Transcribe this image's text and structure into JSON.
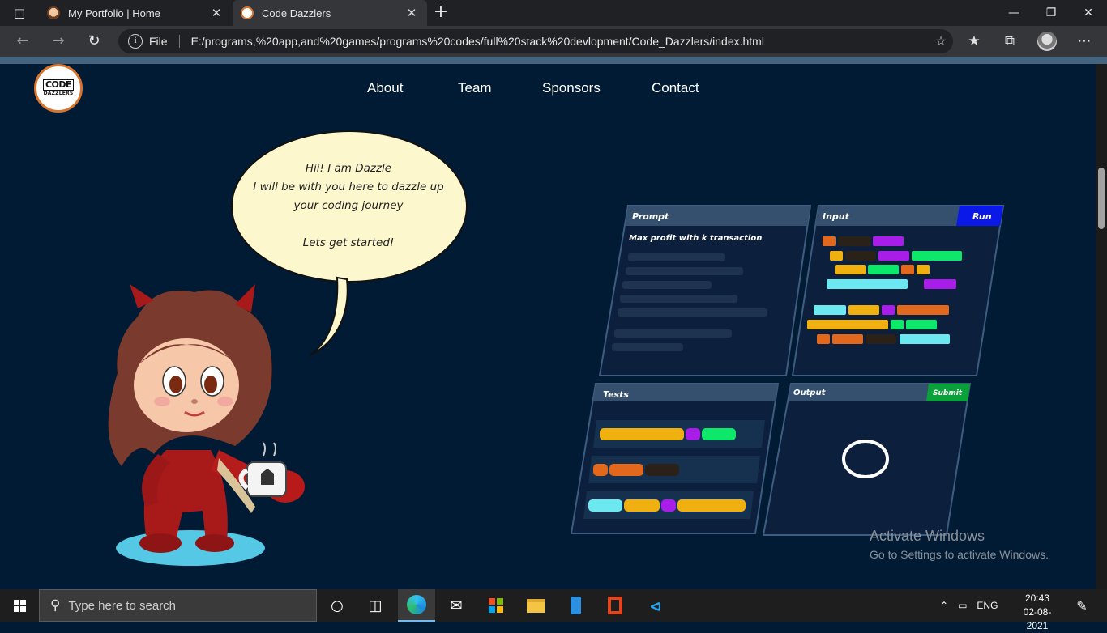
{
  "browser": {
    "tabs": [
      {
        "title": "My Portfolio | Home",
        "active": false
      },
      {
        "title": "Code Dazzlers",
        "active": true
      }
    ],
    "address": {
      "scheme_label": "File",
      "url": "E:/programs,%20app,and%20games/programs%20codes/full%20stack%20devlopment/Code_Dazzlers/index.html"
    }
  },
  "site": {
    "logo_line1": "CODE",
    "logo_line2": "DAZZLERS",
    "nav": [
      "About",
      "Team",
      "Sponsors",
      "Contact"
    ],
    "speech": {
      "line1": "Hii! I am Dazzle",
      "line2": "I will be with you here to dazzle up",
      "line3": "your coding journey",
      "line4": "Lets get started!"
    },
    "illustration": {
      "prompt_title": "Prompt",
      "prompt_heading": "Max profit with k transaction",
      "input_title": "Input",
      "run_label": "Run",
      "tests_title": "Tests",
      "output_title": "Output",
      "submit_label": "Submit"
    }
  },
  "watermark": {
    "title": "Activate Windows",
    "subtitle": "Go to Settings to activate Windows."
  },
  "taskbar": {
    "search_placeholder": "Type here to search",
    "language": "ENG",
    "time": "20:43",
    "date": "02-08-2021"
  },
  "colors": {
    "page_bg": "#001b33",
    "bubble": "#fdf7cd",
    "run_button": "#0a18e8",
    "submit_button": "#0aa13a",
    "mascot_red": "#b81a1a"
  }
}
